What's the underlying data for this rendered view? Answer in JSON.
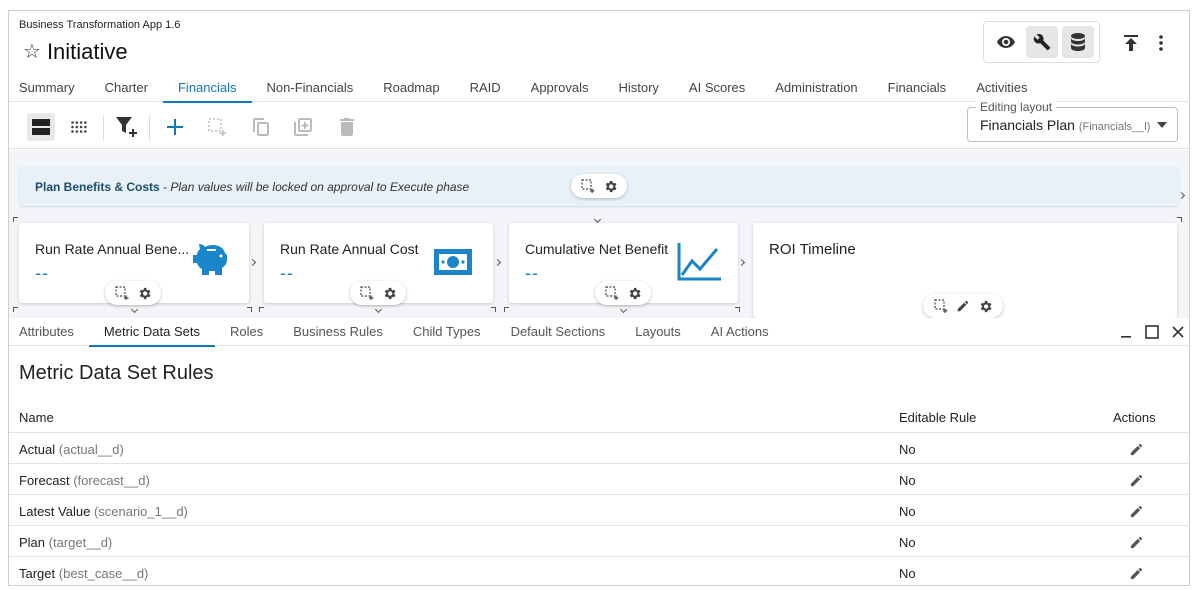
{
  "header": {
    "app_version": "Business Transformation App 1.6",
    "title": "Initiative",
    "icons": [
      "star-icon",
      "eye-icon",
      "wrench-icon",
      "database-icon",
      "publish-icon",
      "more-vert-icon"
    ]
  },
  "tabs": [
    {
      "label": "Summary"
    },
    {
      "label": "Charter"
    },
    {
      "label": "Financials",
      "active": true
    },
    {
      "label": "Non-Financials"
    },
    {
      "label": "Roadmap"
    },
    {
      "label": "RAID"
    },
    {
      "label": "Approvals"
    },
    {
      "label": "History"
    },
    {
      "label": "AI Scores"
    },
    {
      "label": "Administration"
    },
    {
      "label": "Financials"
    },
    {
      "label": "Activities"
    }
  ],
  "layout": {
    "legend": "Editing layout",
    "value": "Financials Plan",
    "code": "(Financials__l)"
  },
  "banner": {
    "title": "Plan Benefits & Costs",
    "separator": " - ",
    "message": "Plan values will be locked on approval to Execute phase"
  },
  "cards": [
    {
      "title": "Run Rate Annual Bene...",
      "value": "--",
      "icon": "piggy-bank-icon"
    },
    {
      "title": "Run Rate Annual Cost",
      "value": "--",
      "icon": "money-icon"
    },
    {
      "title": "Cumulative Net Benefit",
      "value": "--",
      "icon": "line-chart-icon"
    },
    {
      "title": "ROI Timeline"
    }
  ],
  "panel_tabs": [
    {
      "label": "Attributes"
    },
    {
      "label": "Metric Data Sets",
      "active": true
    },
    {
      "label": "Roles"
    },
    {
      "label": "Business Rules"
    },
    {
      "label": "Child Types"
    },
    {
      "label": "Default Sections"
    },
    {
      "label": "Layouts"
    },
    {
      "label": "AI Actions"
    }
  ],
  "section": {
    "title": "Metric Data Set Rules"
  },
  "table": {
    "columns": {
      "name": "Name",
      "editable": "Editable Rule",
      "actions": "Actions"
    },
    "rows": [
      {
        "name": "Actual",
        "code": "(actual__d)",
        "editable": "No"
      },
      {
        "name": "Forecast",
        "code": "(forecast__d)",
        "editable": "No"
      },
      {
        "name": "Latest Value",
        "code": "(scenario_1__d)",
        "editable": "No"
      },
      {
        "name": "Plan",
        "code": "(target__d)",
        "editable": "No"
      },
      {
        "name": "Target",
        "code": "(best_case__d)",
        "editable": "No"
      }
    ]
  },
  "colors": {
    "accent": "#1478b8",
    "card_icon": "#1a85c8"
  }
}
